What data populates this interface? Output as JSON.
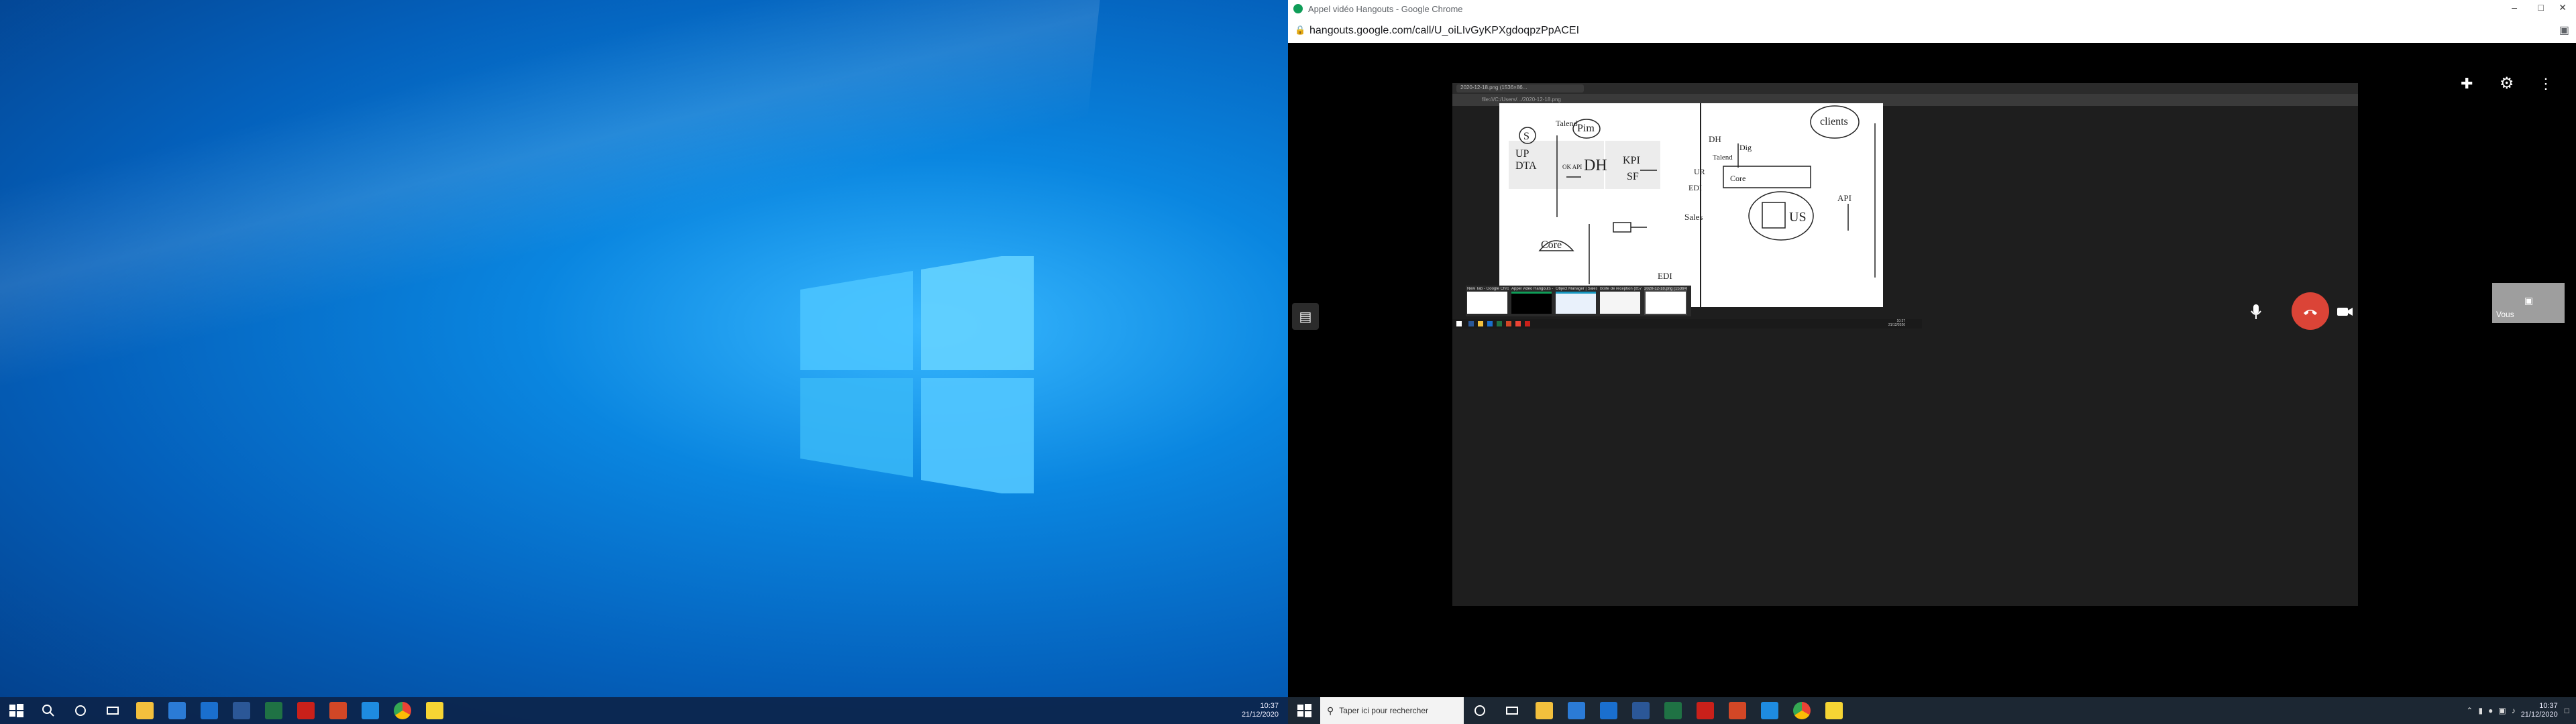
{
  "left_taskbar": {
    "time": "10:37",
    "date": "21/12/2020",
    "icons": [
      "windows-icon",
      "search-icon",
      "cortana-icon",
      "task-view-icon",
      "file-explorer-icon",
      "store-icon",
      "mail-icon",
      "word-icon",
      "excel-icon",
      "acrobat-icon",
      "powerpoint-icon",
      "edge-icon",
      "chrome-icon",
      "sticky-icon"
    ]
  },
  "chrome": {
    "window_title": "Appel vidéo Hangouts - Google Chrome",
    "url": "hangouts.google.com/call/U_oiLIvGyKPXgdoqpzPpACEI"
  },
  "hangouts": {
    "self_label": "Vous",
    "controls": [
      "mic-icon",
      "end-call-icon",
      "camera-icon"
    ]
  },
  "shared_screen": {
    "tab_title": "2020-12-18.png (1536×86...",
    "url": "file:///C:/Users/.../2020-12-18.png",
    "thumbnails": [
      {
        "title": "New Tab - Google Chrome"
      },
      {
        "title": "Appel vidéo Hangouts - Google..."
      },
      {
        "title": "Object Manager | Salesforce -..."
      },
      {
        "title": "Boîte de réception (857) - stefa..."
      },
      {
        "title": "2020-12-18.png (1536×86..."
      }
    ],
    "time": "10:37",
    "date": "21/12/2020"
  },
  "whiteboard": {
    "labels": {
      "s": "S",
      "talend": "Talend",
      "pim": "Pim",
      "up": "UP",
      "dta": "DTA",
      "ok_api": "OK API",
      "dh": "DH",
      "kpi": "KPI",
      "sf": "SF",
      "core": "Core",
      "clients": "clients",
      "dh2": "DH",
      "talend2": "Talend",
      "dig": "Dig",
      "ur": "UR",
      "edi": "EDI",
      "core2": "Core",
      "sales": "Sales",
      "us": "US",
      "api": "API",
      "edi2": "EDI"
    }
  },
  "right_taskbar": {
    "search_placeholder": "Taper ici pour rechercher",
    "time": "10:37",
    "date": "21/12/2020"
  }
}
